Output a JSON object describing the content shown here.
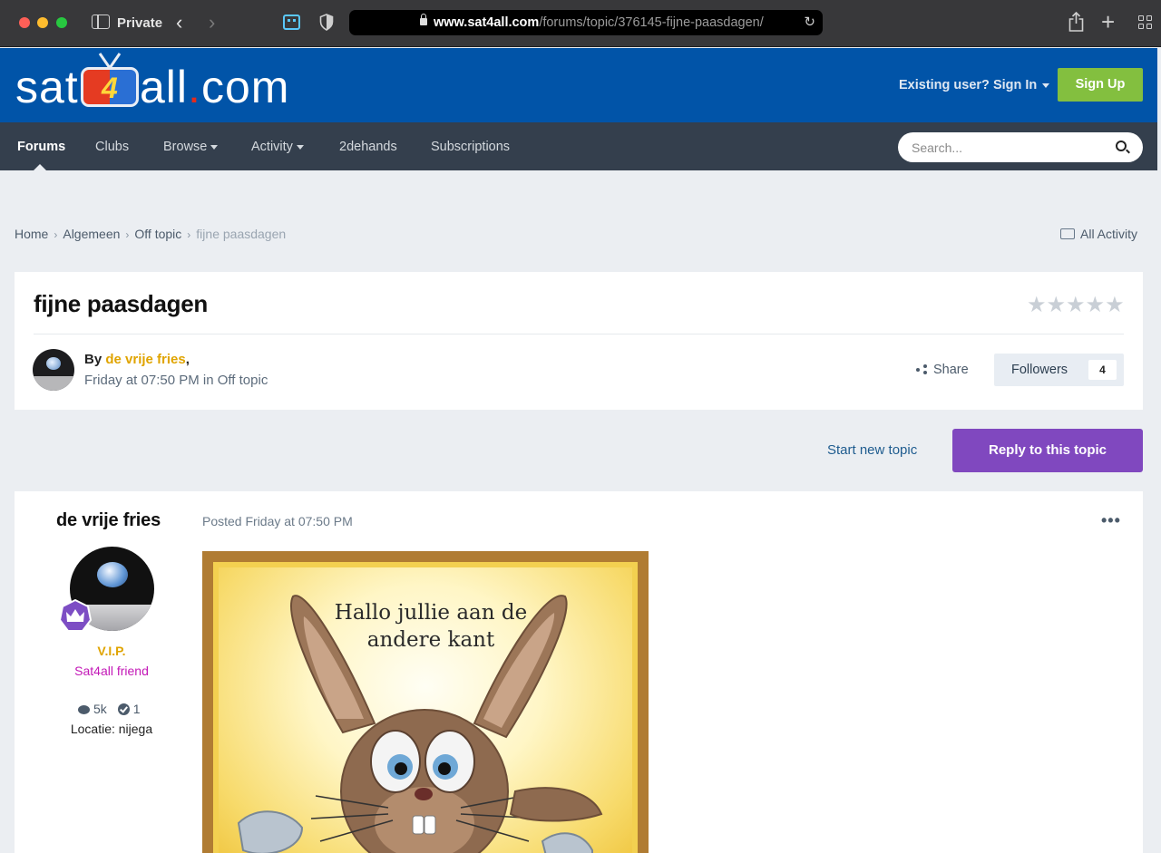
{
  "browser": {
    "private_label": "Private",
    "url_host": "www.sat4all.com",
    "url_path": "/forums/topic/376145-fijne-paasdagen/"
  },
  "header": {
    "logo_left": "sat",
    "logo_four": "4",
    "logo_right": "all",
    "logo_dot": ".",
    "logo_tld": "com",
    "signin_label": "Existing user? Sign In",
    "signup_label": "Sign Up"
  },
  "nav": {
    "items": [
      {
        "label": "Forums"
      },
      {
        "label": "Clubs"
      },
      {
        "label": "Browse"
      },
      {
        "label": "Activity"
      },
      {
        "label": "2dehands"
      },
      {
        "label": "Subscriptions"
      }
    ],
    "search_placeholder": "Search..."
  },
  "breadcrumb": {
    "items": [
      "Home",
      "Algemeen",
      "Off topic",
      "fijne paasdagen"
    ],
    "all_activity": "All Activity"
  },
  "topic": {
    "title": "fijne paasdagen",
    "rating_stars": "★★★★★",
    "by_label": "By",
    "author": "de vrije fries",
    "comma": ",",
    "posted": "Friday at 07:50 PM in Off topic",
    "share_label": "Share",
    "followers_label": "Followers",
    "followers_count": "4"
  },
  "actions": {
    "start_new_topic": "Start new topic",
    "reply": "Reply to this topic"
  },
  "post": {
    "author": "de vrije fries",
    "rank_title": "V.I.P.",
    "group": "Sat4all friend",
    "posts_count": "5k",
    "reputation": "1",
    "location": "Locatie: nijega",
    "posted": "Posted Friday at 07:50 PM",
    "menu_label": "•••",
    "image_text_line1": "Hallo jullie aan de",
    "image_text_line2": "andere kant"
  },
  "colors": {
    "header_blue": "#0154a8",
    "nav_dark": "#343f4d",
    "signup_green": "#83bf3f",
    "reply_purple": "#8048bf",
    "author_gold": "#e0a400",
    "group_magenta": "#c318b7"
  }
}
